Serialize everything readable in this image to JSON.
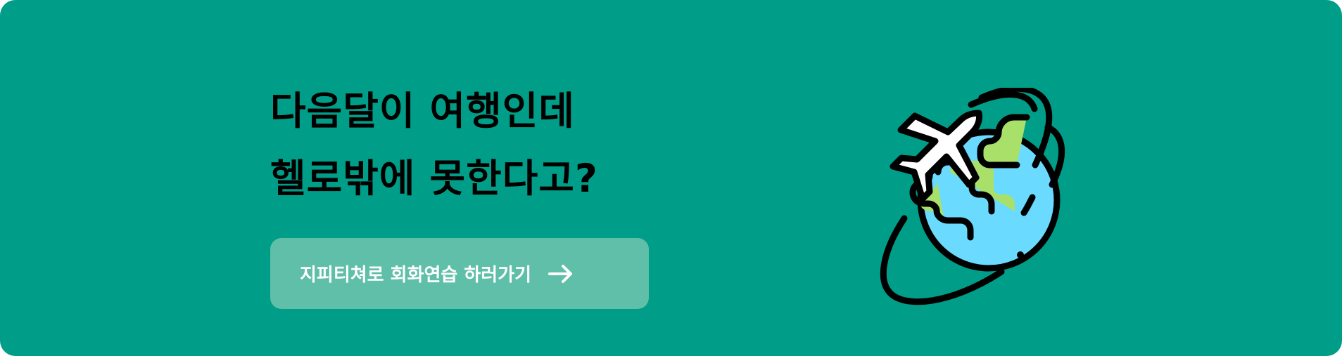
{
  "banner": {
    "title_line1": "다음달이 여행인데",
    "title_line2": "헬로밖에 못한다고?",
    "cta_label": "지피티쳐로 회화연습 하러가기",
    "cta_icon": "arrow-right-icon",
    "illustration_icon": "globe-airplane-icon",
    "colors": {
      "background": "#009E88",
      "button": "#5FBFA9",
      "ocean": "#6ADBFF",
      "land": "#A8E06A"
    }
  }
}
